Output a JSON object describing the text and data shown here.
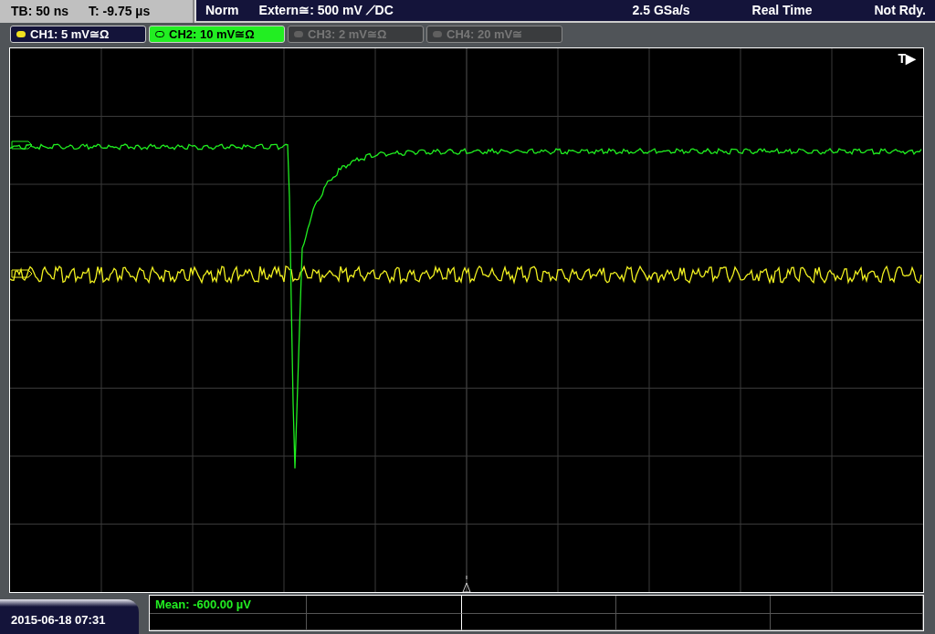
{
  "status_bar": {
    "timebase": "TB: 50 ns",
    "trigger_offset": "T: -9.75 µs",
    "trigger_mode": "Norm",
    "trigger_source": "Extern≅: 500 mV ⟋DC",
    "sample_rate": "2.5 GSa/s",
    "acquisition": "Real Time",
    "state": "Not Rdy."
  },
  "channels": [
    {
      "label": "CH1: 5 mV≅Ω",
      "color": "#f0e020",
      "on": true,
      "selected": false
    },
    {
      "label": "CH2: 10 mV≅Ω",
      "color": "#20ff20",
      "on": true,
      "selected": true
    },
    {
      "label": "CH3: 2 mV≅Ω",
      "color": "#606060",
      "on": false,
      "selected": false
    },
    {
      "label": "CH4: 20 mV≅",
      "color": "#606060",
      "on": false,
      "selected": false
    }
  ],
  "screen": {
    "trigger_marker": "T▶"
  },
  "date_time": "2015-06-18 07:31",
  "measurements": [
    {
      "text": "Mean: -600.00 µV"
    }
  ]
}
